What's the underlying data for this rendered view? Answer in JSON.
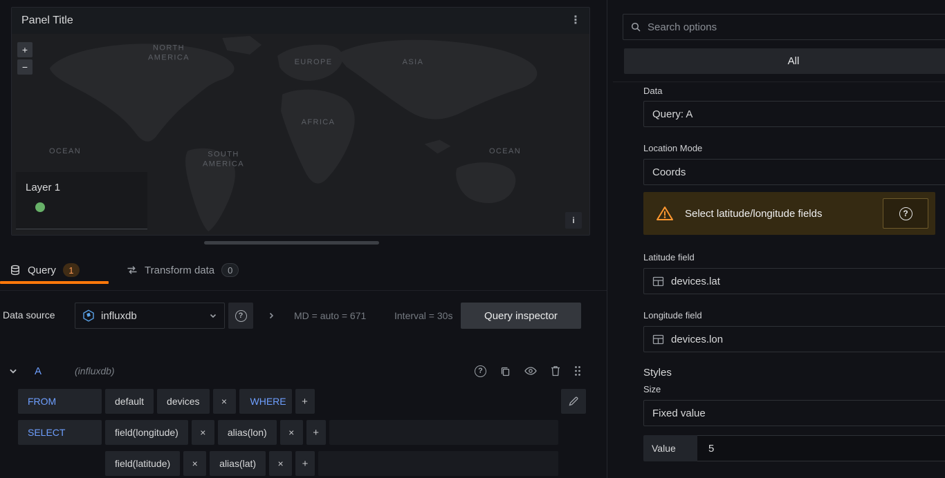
{
  "icons": {
    "kebab": "⋮",
    "info": "i",
    "question": "?",
    "zoom_in": "+",
    "zoom_out": "−",
    "remove": "×",
    "add": "+"
  },
  "colors": {
    "accent_orange": "#ff780a",
    "keyword_blue": "#6e9fff",
    "warning_icon_orange": "#ff9830",
    "layer_dot_green": "#67b168"
  },
  "panel": {
    "title": "Panel Title",
    "layer_label": "Layer 1",
    "map_labels": [
      {
        "text": "NORTH\nAMERICA"
      },
      {
        "text": "EUROPE"
      },
      {
        "text": "ASIA"
      },
      {
        "text": "AFRICA"
      },
      {
        "text": "SOUTH\nAMERICA"
      },
      {
        "text": "OCEAN"
      },
      {
        "text": "OCEAN"
      }
    ]
  },
  "tabs": {
    "query": {
      "label": "Query",
      "count": "1"
    },
    "transform": {
      "label": "Transform data",
      "count": "0"
    }
  },
  "toolbar": {
    "datasource_label": "Data source",
    "datasource_value": "influxdb",
    "stats": "MD = auto = 671",
    "interval": "Interval = 30s",
    "query_inspector": "Query inspector"
  },
  "query_editor": {
    "ref_id": "A",
    "datasource_hint": "(influxdb)",
    "from_label": "FROM",
    "from_database": "default",
    "from_measurement": "devices",
    "where_label": "WHERE",
    "select_label": "SELECT",
    "select_rows": [
      {
        "field": "field(longitude)",
        "alias": "alias(lon)"
      },
      {
        "field": "field(latitude)",
        "alias": "alias(lat)"
      }
    ]
  },
  "sidebar": {
    "search_placeholder": "Search options",
    "filter_all": "All",
    "data_label": "Data",
    "data_value": "Query: A",
    "location_mode_label": "Location Mode",
    "location_mode_value": "Coords",
    "warning_text": "Select latitude/longitude fields",
    "latitude_label": "Latitude field",
    "latitude_value": "devices.lat",
    "longitude_label": "Longitude field",
    "longitude_value": "devices.lon",
    "styles_header": "Styles",
    "size_label": "Size",
    "size_value": "Fixed value",
    "value_label": "Value",
    "value_input": "5"
  }
}
